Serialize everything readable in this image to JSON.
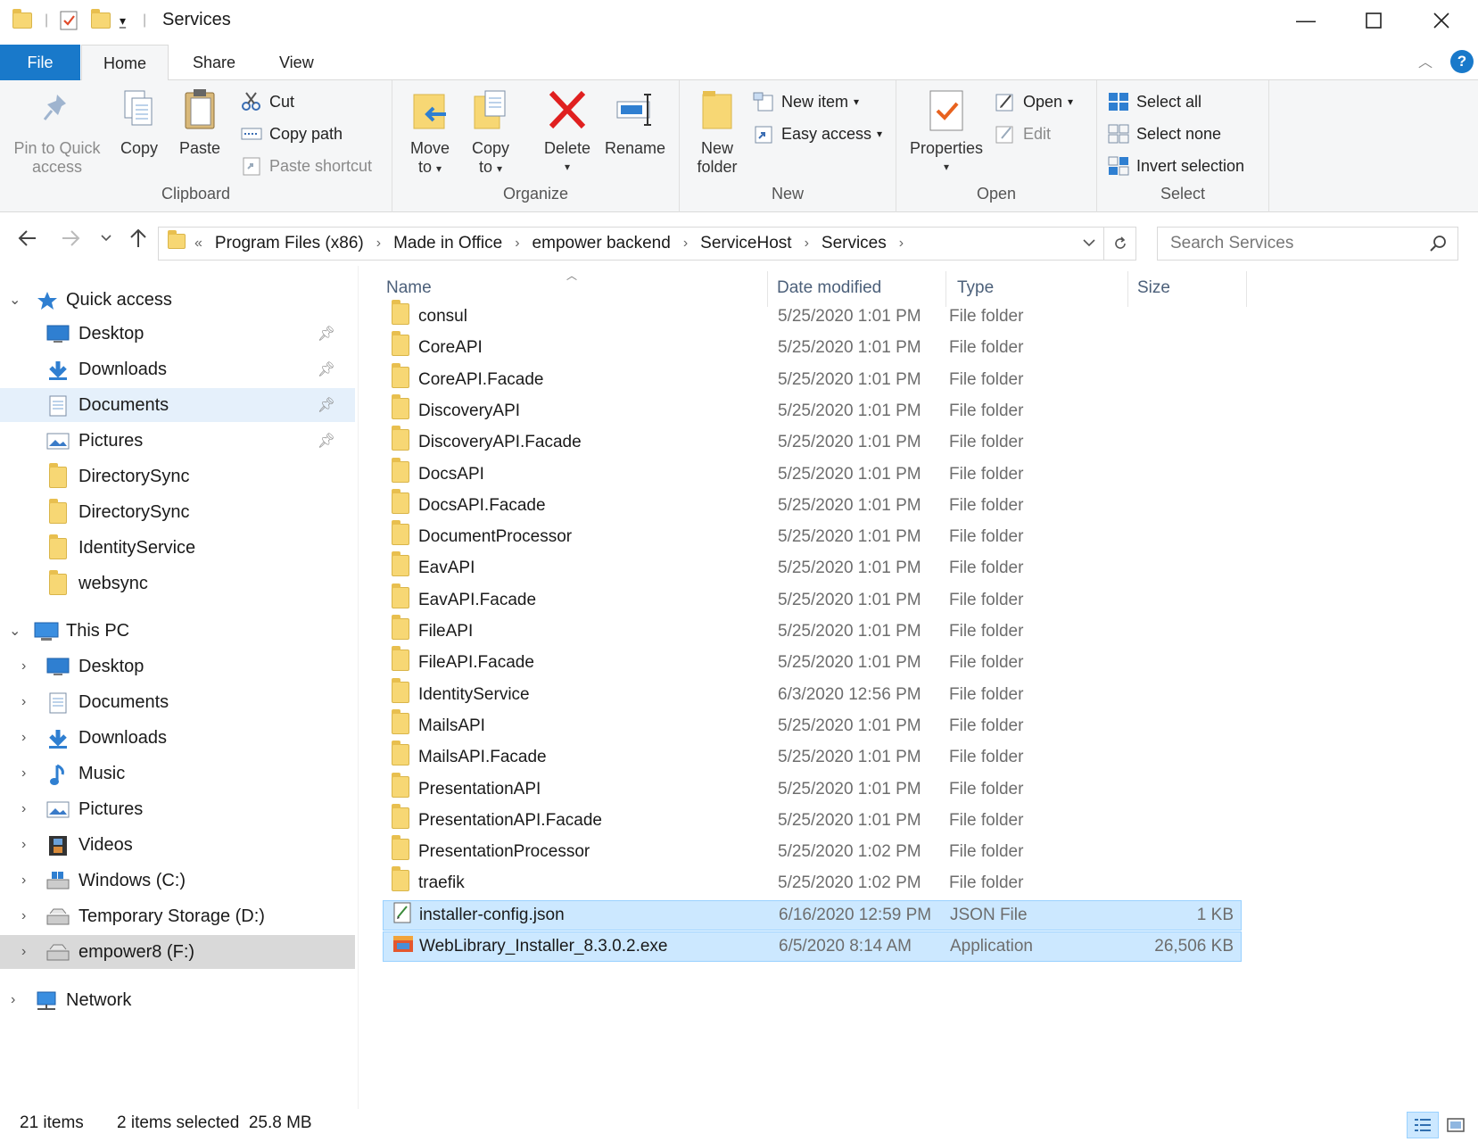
{
  "window": {
    "title": "Services"
  },
  "tabs": [
    {
      "label": "File"
    },
    {
      "label": "Home"
    },
    {
      "label": "Share"
    },
    {
      "label": "View"
    }
  ],
  "ribbon": {
    "clipboard": {
      "label": "Clipboard",
      "pin_line1": "Pin to Quick",
      "pin_line2": "access",
      "copy": "Copy",
      "paste": "Paste",
      "cut": "Cut",
      "copy_path": "Copy path",
      "paste_shortcut": "Paste shortcut"
    },
    "organize": {
      "label": "Organize",
      "move_line1": "Move",
      "move_line2": "to",
      "copyto_line1": "Copy",
      "copyto_line2": "to",
      "delete": "Delete",
      "rename": "Rename"
    },
    "new": {
      "label": "New",
      "folder_line1": "New",
      "folder_line2": "folder",
      "new_item": "New item",
      "easy_access": "Easy access"
    },
    "open": {
      "label": "Open",
      "properties": "Properties",
      "open": "Open",
      "edit": "Edit"
    },
    "select": {
      "label": "Select",
      "select_all": "Select all",
      "select_none": "Select none",
      "invert": "Invert selection"
    }
  },
  "address": {
    "overflow": "«",
    "crumbs": [
      "Program Files (x86)",
      "Made in Office",
      "empower backend",
      "ServiceHost",
      "Services"
    ]
  },
  "search": {
    "placeholder": "Search Services"
  },
  "sidebar": {
    "quick_access": "Quick access",
    "quick_items": [
      {
        "label": "Desktop"
      },
      {
        "label": "Downloads"
      },
      {
        "label": "Documents"
      },
      {
        "label": "Pictures"
      },
      {
        "label": "DirectorySync"
      },
      {
        "label": "DirectorySync"
      },
      {
        "label": "IdentityService"
      },
      {
        "label": "websync"
      }
    ],
    "this_pc": "This PC",
    "pc_items": [
      {
        "label": "Desktop"
      },
      {
        "label": "Documents"
      },
      {
        "label": "Downloads"
      },
      {
        "label": "Music"
      },
      {
        "label": "Pictures"
      },
      {
        "label": "Videos"
      },
      {
        "label": "Windows (C:)"
      },
      {
        "label": "Temporary Storage (D:)"
      },
      {
        "label": "empower8 (F:)"
      }
    ],
    "network": "Network"
  },
  "columns": {
    "name": "Name",
    "date": "Date modified",
    "type": "Type",
    "size": "Size"
  },
  "files": [
    {
      "name": "consul",
      "date": "5/25/2020 1:01 PM",
      "type": "File folder",
      "size": ""
    },
    {
      "name": "CoreAPI",
      "date": "5/25/2020 1:01 PM",
      "type": "File folder",
      "size": ""
    },
    {
      "name": "CoreAPI.Facade",
      "date": "5/25/2020 1:01 PM",
      "type": "File folder",
      "size": ""
    },
    {
      "name": "DiscoveryAPI",
      "date": "5/25/2020 1:01 PM",
      "type": "File folder",
      "size": ""
    },
    {
      "name": "DiscoveryAPI.Facade",
      "date": "5/25/2020 1:01 PM",
      "type": "File folder",
      "size": ""
    },
    {
      "name": "DocsAPI",
      "date": "5/25/2020 1:01 PM",
      "type": "File folder",
      "size": ""
    },
    {
      "name": "DocsAPI.Facade",
      "date": "5/25/2020 1:01 PM",
      "type": "File folder",
      "size": ""
    },
    {
      "name": "DocumentProcessor",
      "date": "5/25/2020 1:01 PM",
      "type": "File folder",
      "size": ""
    },
    {
      "name": "EavAPI",
      "date": "5/25/2020 1:01 PM",
      "type": "File folder",
      "size": ""
    },
    {
      "name": "EavAPI.Facade",
      "date": "5/25/2020 1:01 PM",
      "type": "File folder",
      "size": ""
    },
    {
      "name": "FileAPI",
      "date": "5/25/2020 1:01 PM",
      "type": "File folder",
      "size": ""
    },
    {
      "name": "FileAPI.Facade",
      "date": "5/25/2020 1:01 PM",
      "type": "File folder",
      "size": ""
    },
    {
      "name": "IdentityService",
      "date": "6/3/2020 12:56 PM",
      "type": "File folder",
      "size": ""
    },
    {
      "name": "MailsAPI",
      "date": "5/25/2020 1:01 PM",
      "type": "File folder",
      "size": ""
    },
    {
      "name": "MailsAPI.Facade",
      "date": "5/25/2020 1:01 PM",
      "type": "File folder",
      "size": ""
    },
    {
      "name": "PresentationAPI",
      "date": "5/25/2020 1:01 PM",
      "type": "File folder",
      "size": ""
    },
    {
      "name": "PresentationAPI.Facade",
      "date": "5/25/2020 1:01 PM",
      "type": "File folder",
      "size": ""
    },
    {
      "name": "PresentationProcessor",
      "date": "5/25/2020 1:02 PM",
      "type": "File folder",
      "size": ""
    },
    {
      "name": "traefik",
      "date": "5/25/2020 1:02 PM",
      "type": "File folder",
      "size": ""
    },
    {
      "name": "installer-config.json",
      "date": "6/16/2020 12:59 PM",
      "type": "JSON File",
      "size": "1 KB"
    },
    {
      "name": "WebLibrary_Installer_8.3.0.2.exe",
      "date": "6/5/2020 8:14 AM",
      "type": "Application",
      "size": "26,506 KB"
    }
  ],
  "status": {
    "count": "21 items",
    "selection": "2 items selected  25.8 MB"
  },
  "colors": {
    "accent": "#1979ca",
    "selection": "#cce8ff",
    "folder": "#f7d774"
  }
}
